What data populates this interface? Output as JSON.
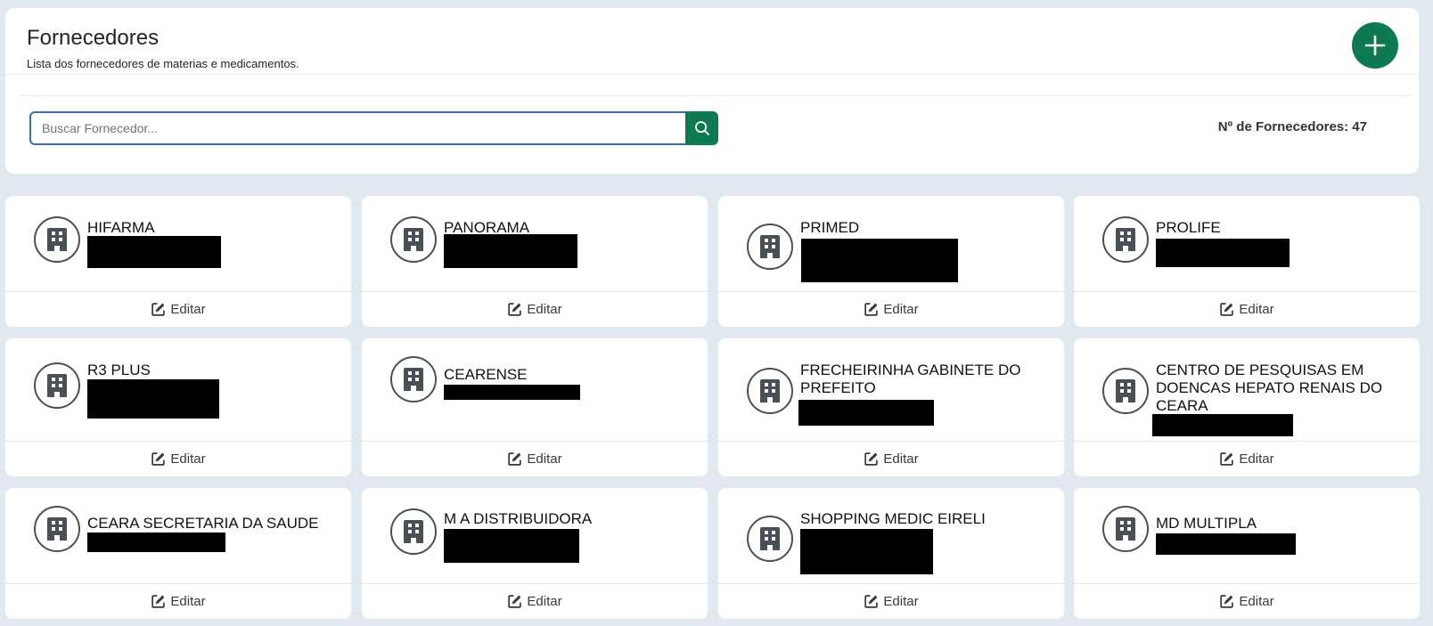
{
  "header": {
    "title": "Fornecedores",
    "subtitle": "Lista dos fornecedores de materias e medicamentos."
  },
  "search": {
    "placeholder": "Buscar Fornecedor...",
    "value": ""
  },
  "count": {
    "text": "Nº de Fornecedores: 47"
  },
  "colors": {
    "accent": "#0e7a52",
    "page_background": "#e2e8f0",
    "input_border": "#3b6db3"
  },
  "icons": {
    "add": "plus-icon",
    "search": "search-icon",
    "supplier": "building-icon",
    "edit": "edit-icon"
  },
  "suppliers": [
    {
      "name": "HIFARMA",
      "edit_label": "Editar"
    },
    {
      "name": "PANORAMA",
      "edit_label": "Editar"
    },
    {
      "name": "PRIMED",
      "edit_label": "Editar"
    },
    {
      "name": "PROLIFE",
      "edit_label": "Editar"
    },
    {
      "name": "R3 PLUS",
      "edit_label": "Editar"
    },
    {
      "name": "CEARENSE",
      "edit_label": "Editar"
    },
    {
      "name": "FRECHEIRINHA GABINETE DO PREFEITO",
      "edit_label": "Editar"
    },
    {
      "name": "CENTRO DE PESQUISAS EM DOENCAS HEPATO RENAIS DO CEARA",
      "edit_label": "Editar"
    },
    {
      "name": "CEARA SECRETARIA DA SAUDE",
      "edit_label": "Editar"
    },
    {
      "name": "M A DISTRIBUIDORA",
      "edit_label": "Editar"
    },
    {
      "name": "SHOPPING MEDIC EIRELI",
      "edit_label": "Editar"
    },
    {
      "name": "MD MULTIPLA",
      "edit_label": "Editar"
    }
  ]
}
